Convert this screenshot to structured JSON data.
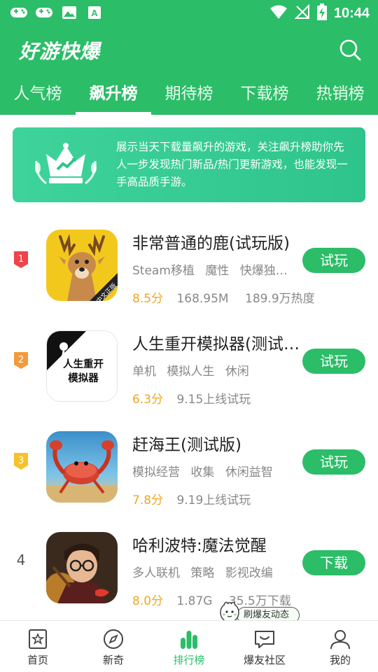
{
  "status_bar": {
    "time": "10:44"
  },
  "app": {
    "title": "好游快爆"
  },
  "tabs": [
    {
      "label": "人气榜"
    },
    {
      "label": "飙升榜"
    },
    {
      "label": "期待榜"
    },
    {
      "label": "下载榜"
    },
    {
      "label": "热销榜"
    }
  ],
  "banner": {
    "text": "展示当天下载量飙升的游戏，关注飙升榜助你先人一步发现热门新品/热门更新游戏，也能发现一手高品质手游。"
  },
  "games": [
    {
      "rank": "1",
      "name": "非常普通的鹿(试玩版)",
      "tags": [
        "Steam移植",
        "魔性",
        "快爆独…"
      ],
      "score": "8.5分",
      "info": [
        "168.95M",
        "189.9万热度"
      ],
      "action": "试玩",
      "icon_badge": "中文正版",
      "rank_color": "#f0434a"
    },
    {
      "rank": "2",
      "name": "人生重开模拟器(测试…",
      "tags": [
        "单机",
        "模拟人生",
        "休闲"
      ],
      "score": "6.3分",
      "info": [
        "9.15上线试玩"
      ],
      "action": "试玩",
      "icon_text": "人生重开模拟器",
      "rank_color": "#f39a3a"
    },
    {
      "rank": "3",
      "name": "赶海王(测试版)",
      "tags": [
        "模拟经营",
        "收集",
        "休闲益智"
      ],
      "score": "7.8分",
      "info": [
        "9.19上线试玩"
      ],
      "action": "试玩",
      "rank_color": "#f6c22a"
    },
    {
      "rank": "4",
      "name": "哈利波特:魔法觉醒",
      "tags": [
        "多人联机",
        "策略",
        "影视改编"
      ],
      "score": "8.0分",
      "info": [
        "1.87G",
        "35.5万下载"
      ],
      "action": "下载"
    }
  ],
  "floating": {
    "label": "刷爆友动态"
  },
  "bottom_nav": [
    {
      "label": "首页"
    },
    {
      "label": "新奇"
    },
    {
      "label": "排行榜"
    },
    {
      "label": "爆友社区"
    },
    {
      "label": "我的"
    }
  ],
  "colors": {
    "brand": "#2bbd67",
    "score": "#f0a81e"
  }
}
